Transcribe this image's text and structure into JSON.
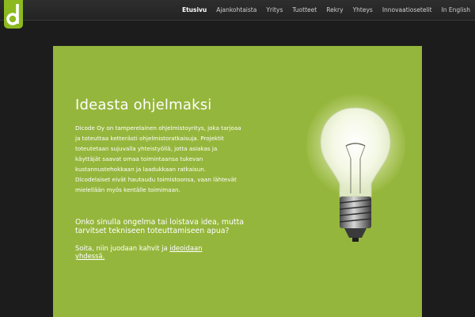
{
  "logo": {
    "letter": "d",
    "color": "#8cb91f"
  },
  "nav": {
    "items": [
      {
        "label": "Etusivu",
        "active": true
      },
      {
        "label": "Ajankohtaista"
      },
      {
        "label": "Yritys"
      },
      {
        "label": "Tuotteet"
      },
      {
        "label": "Rekry"
      },
      {
        "label": "Yhteys"
      },
      {
        "label": "Innovaatiosetelit"
      },
      {
        "label": "In English"
      }
    ]
  },
  "hero": {
    "headline": "Ideasta ohjelmaksi",
    "body": "Dicode Oy on tamperelainen ohjelmistoyritys, joka tarjoaa ja toteuttaa ketterästi ohjelmistoratkaisuja. Projektit toteutetaan sujuvalla yhteistyöllä, jotta asiakas ja käyttäjät saavat omaa toimintaansa tukevan kustannustehokkaan ja laadukkaan ratkaisun. Dicodelaiset eivät hautaudu toimistoonsa, vaan lähtevät mielellään myös kentälle toimimaan.",
    "question": "Onko sinulla ongelma tai loistava idea, mutta tarvitset tekniseen toteuttamiseen apua?",
    "cta_text": "Soita, niin juodaan kahvit ja ",
    "cta_link": "ideoidaan yhdessä."
  },
  "colors": {
    "background": "#1c1c1c",
    "stage": "#95b63c",
    "accent": "#8cb91f"
  }
}
